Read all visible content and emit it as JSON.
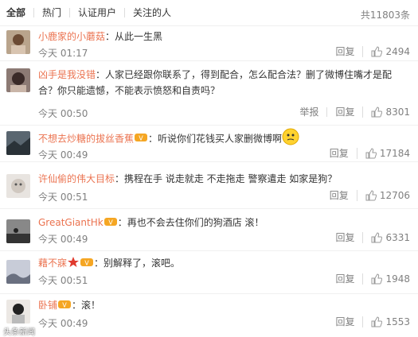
{
  "tabs": [
    "全部",
    "热门",
    "认证用户",
    "关注的人"
  ],
  "total": "共11803条",
  "actions": {
    "reply": "回复",
    "report": "举报"
  },
  "comments": [
    {
      "name": "小鹿家的小蘑菇",
      "text": "：从此一生黑",
      "time": "今天 01:17",
      "likes": "2494"
    },
    {
      "name": "凶手是我没错",
      "text": "：人家已经跟你联系了，得到配合，怎么配合法？删了微博住嘴才是配合？你只能遗憾，不能表示愤怒和自责吗？",
      "time": "今天 00:50",
      "likes": "8301"
    },
    {
      "name": "不想去炒糖的拔丝香蕉",
      "text": "：听说你们花钱买人家删微博啊",
      "time": "今天 00:49",
      "likes": "17184"
    },
    {
      "name": "许仙偷的伟大目标",
      "text": "：携程在手 说走就走 不走拖走 警察遣走 如家是狗？",
      "time": "今天 00:51",
      "likes": "12706"
    },
    {
      "name": "GreatGiantHk",
      "text": "：再也不会去住你们的狗酒店 滚！",
      "time": "今天 00:49",
      "likes": "6331"
    },
    {
      "name": "藉不寐",
      "text": "：别解释了，滚吧。",
      "time": "今天 00:51",
      "likes": "1948"
    },
    {
      "name": "卧铺",
      "text": "：滚！",
      "time": "今天 00:49",
      "likes": "1553"
    }
  ],
  "watermark": "头条新闻"
}
